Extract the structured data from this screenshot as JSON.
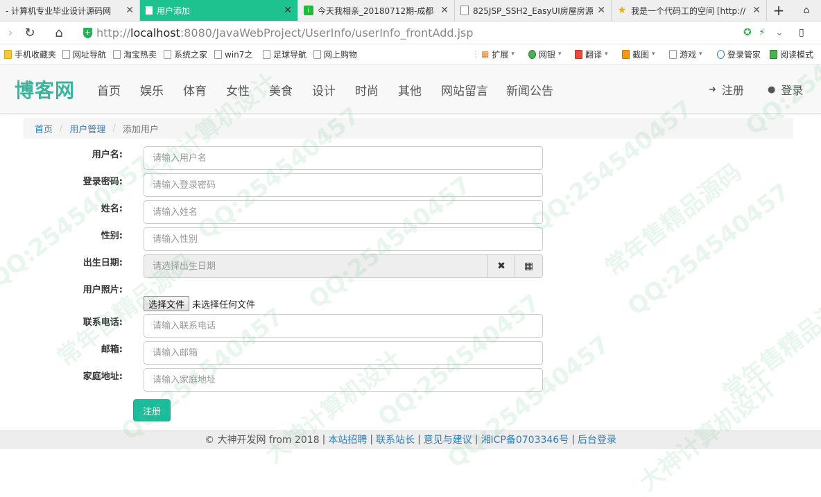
{
  "browser": {
    "tabs": [
      {
        "title": "- 计算机专业毕业设计源码网",
        "active": false
      },
      {
        "title": "用户添加",
        "active": true
      },
      {
        "title": "今天我相亲_20180712期-成都",
        "active": false
      },
      {
        "title": "825JSP_SSH2_EasyUI房屋房源",
        "active": false
      },
      {
        "title": "我是一个代码工的空间 [http://",
        "active": false
      }
    ],
    "new_tab_label": "+",
    "url_scheme": "http://",
    "url_host": "localhost",
    "url_rest": ":8080/JavaWebProject/UserInfo/userInfo_frontAdd.jsp",
    "bookmarks": [
      "手机收藏夹",
      "网址导航",
      "淘宝热卖",
      "系统之家",
      "win7之",
      "足球导航",
      "网上购物"
    ],
    "toolbar_items": [
      "扩展",
      "网银",
      "翻译",
      "截图",
      "游戏",
      "登录管家",
      "阅读模式"
    ]
  },
  "site": {
    "brand": "博客网",
    "nav": [
      "首页",
      "娱乐",
      "体育",
      "女性",
      "美食",
      "设计",
      "时尚",
      "其他",
      "网站留言",
      "新闻公告"
    ],
    "register": "注册",
    "login": "登录"
  },
  "breadcrumb": {
    "home": "首页",
    "section": "用户管理",
    "current": "添加用户",
    "separator": "/"
  },
  "form": {
    "username": {
      "label": "用户名:",
      "placeholder": "请输入用户名"
    },
    "password": {
      "label": "登录密码:",
      "placeholder": "请输入登录密码"
    },
    "name": {
      "label": "姓名:",
      "placeholder": "请输入姓名"
    },
    "gender": {
      "label": "性别:",
      "placeholder": "请输入性别"
    },
    "birthdate": {
      "label": "出生日期:",
      "placeholder": "请选择出生日期"
    },
    "photo": {
      "label": "用户照片:",
      "button": "选择文件",
      "status": "未选择任何文件"
    },
    "phone": {
      "label": "联系电话:",
      "placeholder": "请输入联系电话"
    },
    "email": {
      "label": "邮箱:",
      "placeholder": "请输入邮箱"
    },
    "address": {
      "label": "家庭地址:",
      "placeholder": "请输入家庭地址"
    },
    "submit": "注册"
  },
  "footer": {
    "copyright": "© 大神开发网 from 2018",
    "links": [
      "本站招聘",
      "联系站长",
      "意见与建议",
      "湘ICP备0703346号",
      "后台登录"
    ],
    "separator": "|"
  },
  "watermark": {
    "qq": "QQ:25454045​7",
    "slogan1": "常年售精品源码",
    "slogan2": "大神计算机设计"
  },
  "colors": {
    "brand": "#3ab59c",
    "active_tab": "#1dc28f",
    "submit": "#1abc9c",
    "link": "#337ab7"
  }
}
